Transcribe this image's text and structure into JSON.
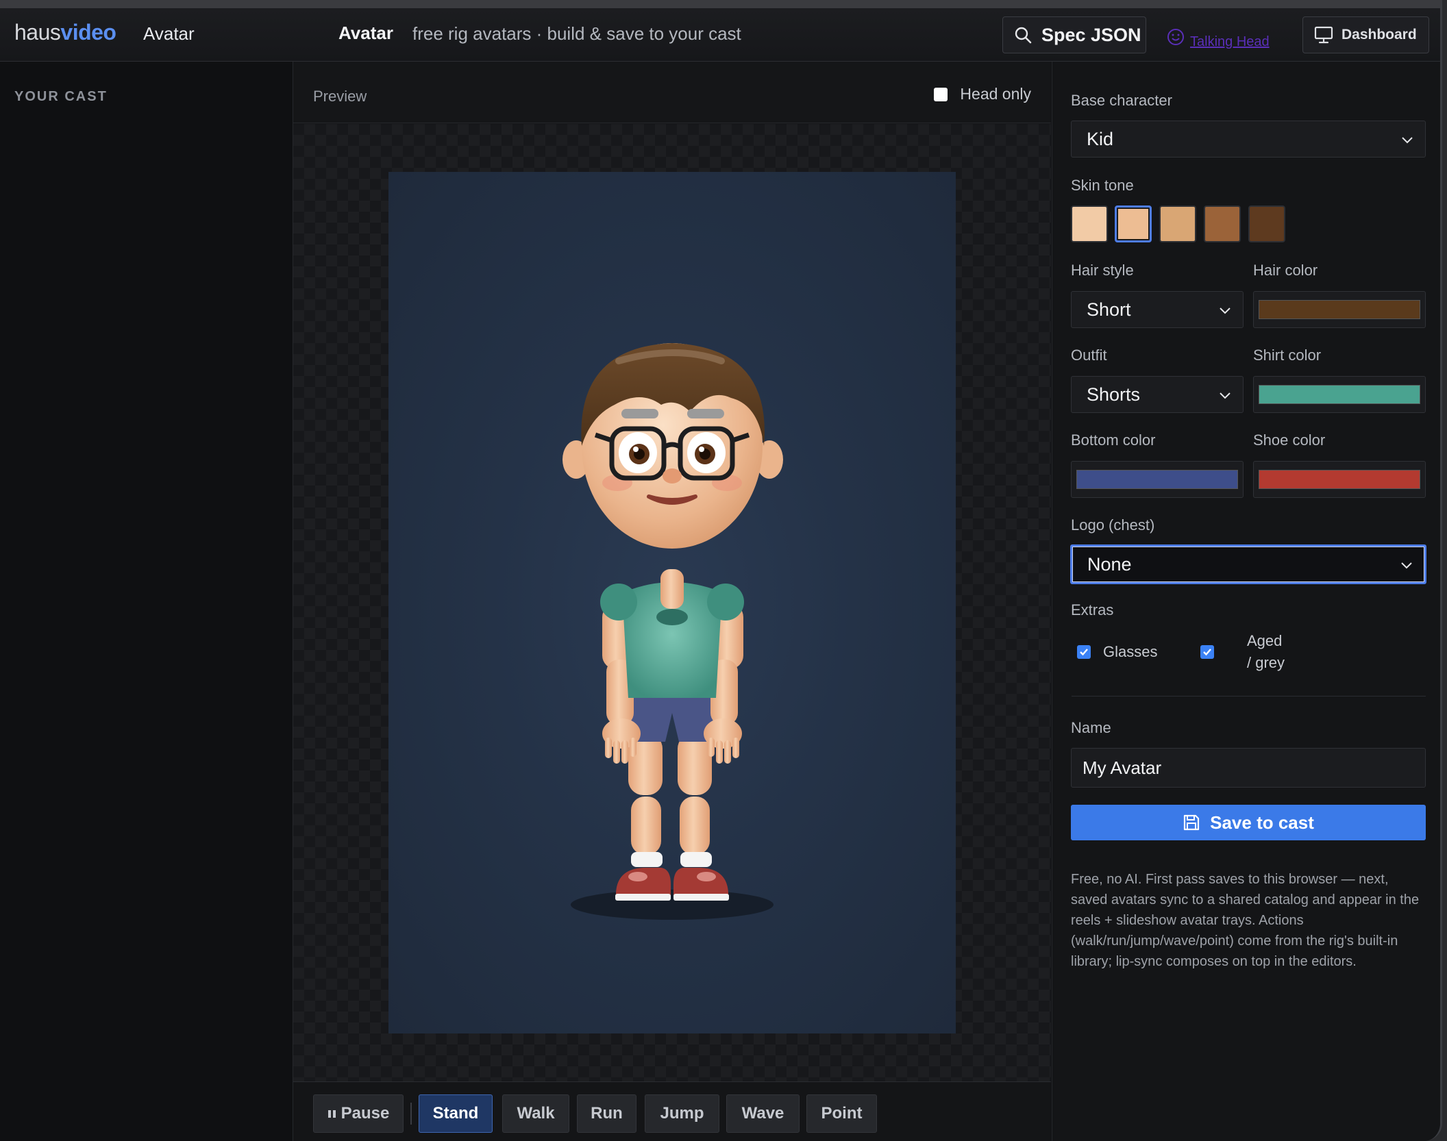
{
  "header": {
    "brand_part1": "haus",
    "brand_part2": "video",
    "nav_item": "Avatar",
    "page_title": "Avatar",
    "page_subtitle": "free rig avatars · build & save to your cast",
    "spec_button": "Spec JSON",
    "talking_head_link": "Talking Head",
    "dashboard_button": "Dashboard"
  },
  "sidebar": {
    "heading": "YOUR CAST"
  },
  "preview": {
    "label": "Preview",
    "head_only_label": "Head only",
    "head_only_checked": false
  },
  "actions": {
    "pause": "Pause",
    "items": [
      "Stand",
      "Walk",
      "Run",
      "Jump",
      "Wave",
      "Point"
    ],
    "active": "Stand"
  },
  "form": {
    "base_character_label": "Base character",
    "base_character_value": "Kid",
    "skin_tone_label": "Skin tone",
    "skin_tones": [
      "#f2cba6",
      "#edbd93",
      "#d9a674",
      "#9b6339",
      "#5e3a1f"
    ],
    "skin_tone_selected": "#edbd93",
    "hair_style_label": "Hair style",
    "hair_style_value": "Short",
    "hair_color_label": "Hair color",
    "hair_color": "#5a3a1c",
    "outfit_label": "Outfit",
    "outfit_value": "Shorts",
    "shirt_color_label": "Shirt color",
    "shirt_color": "#4aa390",
    "bottom_color_label": "Bottom color",
    "bottom_color": "#3e4e8a",
    "shoe_color_label": "Shoe color",
    "shoe_color": "#b33a30",
    "logo_label": "Logo (chest)",
    "logo_value": "None",
    "extras_label": "Extras",
    "extra_glasses": "Glasses",
    "extra_aged_line1": "Aged",
    "extra_aged_line2": "/ grey",
    "name_label": "Name",
    "name_value": "My Avatar",
    "save_button": "Save to cast",
    "note": "Free, no AI. First pass saves to this browser — next, saved avatars sync to a shared catalog and appear in the reels + slideshow avatar trays. Actions (walk/run/jump/wave/point) come from the rig's built-in library; lip-sync composes on top in the editors."
  },
  "colors": {
    "accent": "#3b7ae8",
    "active_action_bg": "#1f3764",
    "canvas_bg": "#243247"
  }
}
